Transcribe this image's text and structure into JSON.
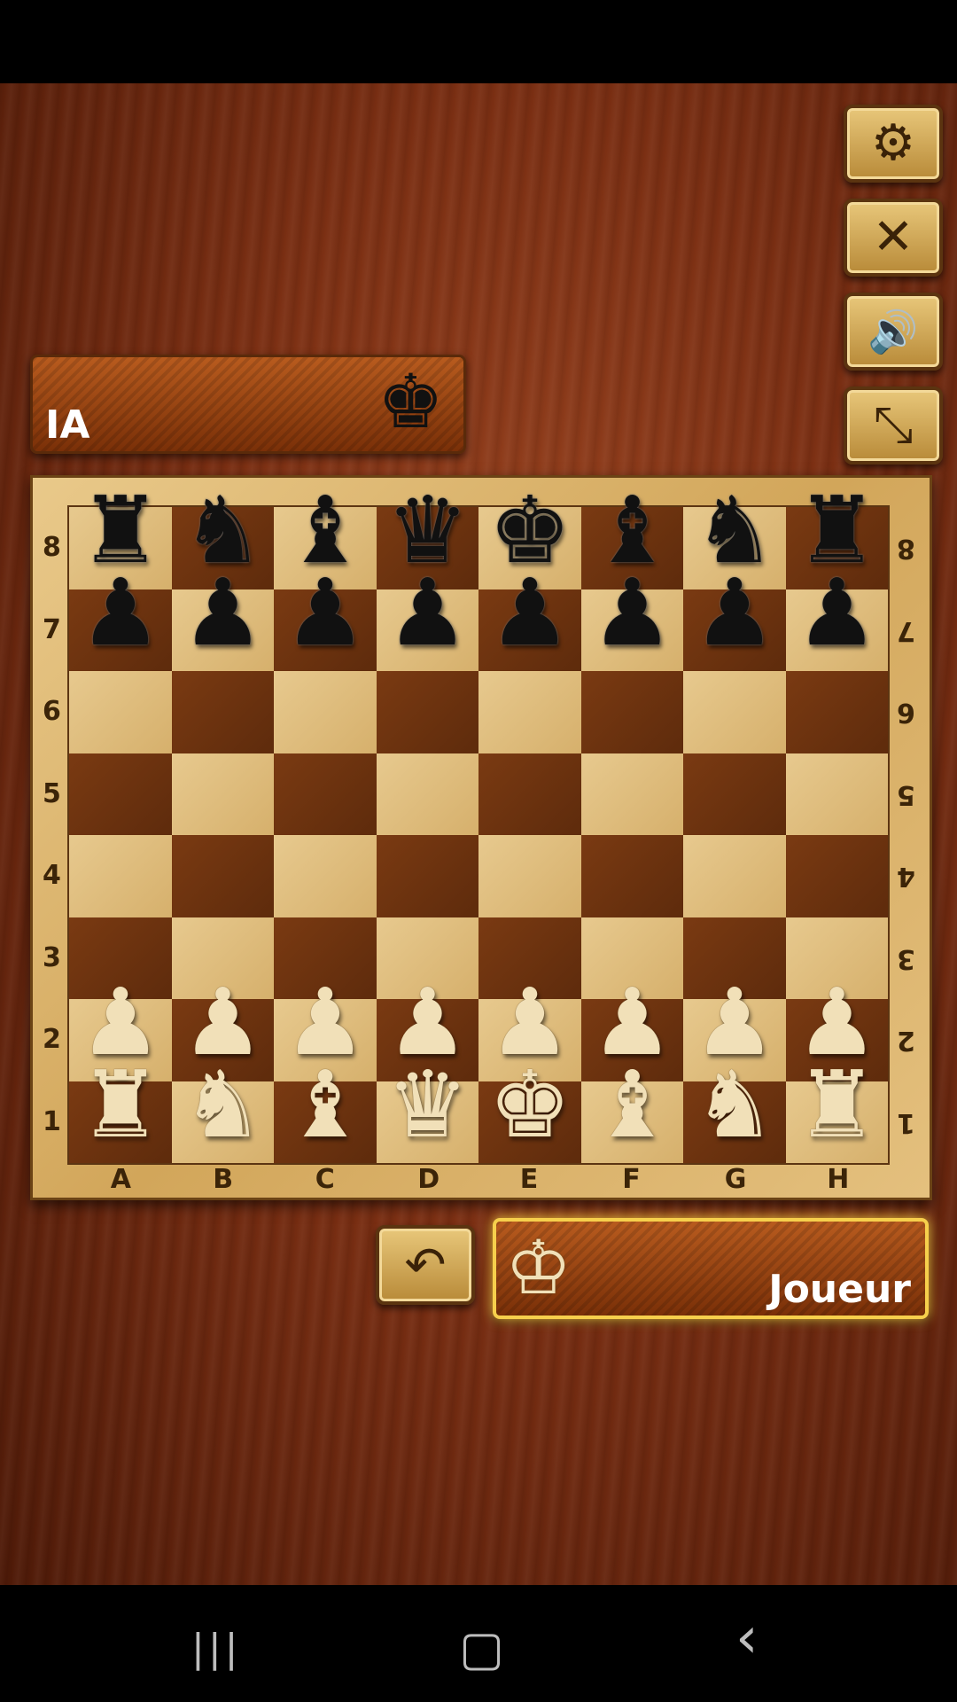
{
  "players": {
    "ai_name": "IA",
    "player_name": "Joueur"
  },
  "icons": {
    "king_black": "♚",
    "king_white": "♔",
    "settings": "⚙",
    "close": "✕",
    "sound": "🔊",
    "fullscreen": "⤡",
    "undo": "↶",
    "nav_recent": "|||",
    "nav_home": "▢",
    "nav_back": "‹"
  },
  "board": {
    "files": [
      "A",
      "B",
      "C",
      "D",
      "E",
      "F",
      "G",
      "H"
    ],
    "ranks": [
      "8",
      "7",
      "6",
      "5",
      "4",
      "3",
      "2",
      "1"
    ],
    "pieces": [
      {
        "sq": "A8",
        "glyph": "♜",
        "color": "black"
      },
      {
        "sq": "B8",
        "glyph": "♞",
        "color": "black"
      },
      {
        "sq": "C8",
        "glyph": "♝",
        "color": "black"
      },
      {
        "sq": "D8",
        "glyph": "♛",
        "color": "black"
      },
      {
        "sq": "E8",
        "glyph": "♚",
        "color": "black"
      },
      {
        "sq": "F8",
        "glyph": "♝",
        "color": "black"
      },
      {
        "sq": "G8",
        "glyph": "♞",
        "color": "black"
      },
      {
        "sq": "H8",
        "glyph": "♜",
        "color": "black"
      },
      {
        "sq": "A7",
        "glyph": "♟",
        "color": "black"
      },
      {
        "sq": "B7",
        "glyph": "♟",
        "color": "black"
      },
      {
        "sq": "C7",
        "glyph": "♟",
        "color": "black"
      },
      {
        "sq": "D7",
        "glyph": "♟",
        "color": "black"
      },
      {
        "sq": "E7",
        "glyph": "♟",
        "color": "black"
      },
      {
        "sq": "F7",
        "glyph": "♟",
        "color": "black"
      },
      {
        "sq": "G7",
        "glyph": "♟",
        "color": "black"
      },
      {
        "sq": "H7",
        "glyph": "♟",
        "color": "black"
      },
      {
        "sq": "A2",
        "glyph": "♟",
        "color": "white"
      },
      {
        "sq": "B2",
        "glyph": "♟",
        "color": "white"
      },
      {
        "sq": "C2",
        "glyph": "♟",
        "color": "white"
      },
      {
        "sq": "D2",
        "glyph": "♟",
        "color": "white"
      },
      {
        "sq": "E2",
        "glyph": "♟",
        "color": "white"
      },
      {
        "sq": "F2",
        "glyph": "♟",
        "color": "white"
      },
      {
        "sq": "G2",
        "glyph": "♟",
        "color": "white"
      },
      {
        "sq": "H2",
        "glyph": "♟",
        "color": "white"
      },
      {
        "sq": "A1",
        "glyph": "♜",
        "color": "white"
      },
      {
        "sq": "B1",
        "glyph": "♞",
        "color": "white"
      },
      {
        "sq": "C1",
        "glyph": "♝",
        "color": "white"
      },
      {
        "sq": "D1",
        "glyph": "♛",
        "color": "white"
      },
      {
        "sq": "E1",
        "glyph": "♚",
        "color": "white"
      },
      {
        "sq": "F1",
        "glyph": "♝",
        "color": "white"
      },
      {
        "sq": "G1",
        "glyph": "♞",
        "color": "white"
      },
      {
        "sq": "H1",
        "glyph": "♜",
        "color": "white"
      }
    ]
  }
}
